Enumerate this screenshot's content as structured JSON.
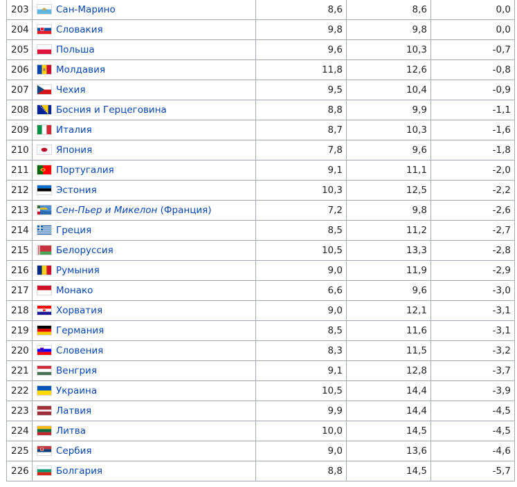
{
  "rows": [
    {
      "rank": "203",
      "country": "Сан-Марино",
      "suffix": "",
      "italic": false,
      "flag": "san-marino",
      "v1": "8,6",
      "v2": "8,6",
      "diff": "0,0"
    },
    {
      "rank": "204",
      "country": "Словакия",
      "suffix": "",
      "italic": false,
      "flag": "slovakia",
      "v1": "9,8",
      "v2": "9,8",
      "diff": "0,0"
    },
    {
      "rank": "205",
      "country": "Польша",
      "suffix": "",
      "italic": false,
      "flag": "poland",
      "v1": "9,6",
      "v2": "10,3",
      "diff": "-0,7"
    },
    {
      "rank": "206",
      "country": "Молдавия",
      "suffix": "",
      "italic": false,
      "flag": "moldova",
      "v1": "11,8",
      "v2": "12,6",
      "diff": "-0,8"
    },
    {
      "rank": "207",
      "country": "Чехия",
      "suffix": "",
      "italic": false,
      "flag": "czechia",
      "v1": "9,5",
      "v2": "10,4",
      "diff": "-0,9"
    },
    {
      "rank": "208",
      "country": "Босния и Герцеговина",
      "suffix": "",
      "italic": false,
      "flag": "bosnia",
      "v1": "8,8",
      "v2": "9,9",
      "diff": "-1,1"
    },
    {
      "rank": "209",
      "country": "Италия",
      "suffix": "",
      "italic": false,
      "flag": "italy",
      "v1": "8,7",
      "v2": "10,3",
      "diff": "-1,6"
    },
    {
      "rank": "210",
      "country": "Япония",
      "suffix": "",
      "italic": false,
      "flag": "japan",
      "v1": "7,8",
      "v2": "9,6",
      "diff": "-1,8"
    },
    {
      "rank": "211",
      "country": "Португалия",
      "suffix": "",
      "italic": false,
      "flag": "portugal",
      "v1": "9,1",
      "v2": "11,1",
      "diff": "-2,0"
    },
    {
      "rank": "212",
      "country": "Эстония",
      "suffix": "",
      "italic": false,
      "flag": "estonia",
      "v1": "10,3",
      "v2": "12,5",
      "diff": "-2,2"
    },
    {
      "rank": "213",
      "country": "Сен-Пьер и Микелон",
      "suffix": " (Франция)",
      "italic": true,
      "flag": "spm",
      "v1": "7,2",
      "v2": "9,8",
      "diff": "-2,6"
    },
    {
      "rank": "214",
      "country": "Греция",
      "suffix": "",
      "italic": false,
      "flag": "greece",
      "v1": "8,5",
      "v2": "11,2",
      "diff": "-2,7"
    },
    {
      "rank": "215",
      "country": "Белоруссия",
      "suffix": "",
      "italic": false,
      "flag": "belarus",
      "v1": "10,5",
      "v2": "13,3",
      "diff": "-2,8"
    },
    {
      "rank": "216",
      "country": "Румыния",
      "suffix": "",
      "italic": false,
      "flag": "romania",
      "v1": "9,0",
      "v2": "11,9",
      "diff": "-2,9"
    },
    {
      "rank": "217",
      "country": "Монако",
      "suffix": "",
      "italic": false,
      "flag": "monaco",
      "v1": "6,6",
      "v2": "9,6",
      "diff": "-3,0"
    },
    {
      "rank": "218",
      "country": "Хорватия",
      "suffix": "",
      "italic": false,
      "flag": "croatia",
      "v1": "9,0",
      "v2": "12,1",
      "diff": "-3,1"
    },
    {
      "rank": "219",
      "country": "Германия",
      "suffix": "",
      "italic": false,
      "flag": "germany",
      "v1": "8,5",
      "v2": "11,6",
      "diff": "-3,1"
    },
    {
      "rank": "220",
      "country": "Словения",
      "suffix": "",
      "italic": false,
      "flag": "slovenia",
      "v1": "8,3",
      "v2": "11,5",
      "diff": "-3,2"
    },
    {
      "rank": "221",
      "country": "Венгрия",
      "suffix": "",
      "italic": false,
      "flag": "hungary",
      "v1": "9,1",
      "v2": "12,8",
      "diff": "-3,7"
    },
    {
      "rank": "222",
      "country": "Украина",
      "suffix": "",
      "italic": false,
      "flag": "ukraine",
      "v1": "10,5",
      "v2": "14,4",
      "diff": "-3,9"
    },
    {
      "rank": "223",
      "country": "Латвия",
      "suffix": "",
      "italic": false,
      "flag": "latvia",
      "v1": "9,9",
      "v2": "14,4",
      "diff": "-4,5"
    },
    {
      "rank": "224",
      "country": "Литва",
      "suffix": "",
      "italic": false,
      "flag": "lithuania",
      "v1": "10,0",
      "v2": "14,5",
      "diff": "-4,5"
    },
    {
      "rank": "225",
      "country": "Сербия",
      "suffix": "",
      "italic": false,
      "flag": "serbia",
      "v1": "9,0",
      "v2": "13,6",
      "diff": "-4,6"
    },
    {
      "rank": "226",
      "country": "Болгария",
      "suffix": "",
      "italic": false,
      "flag": "bulgaria",
      "v1": "8,8",
      "v2": "14,5",
      "diff": "-5,7"
    }
  ]
}
